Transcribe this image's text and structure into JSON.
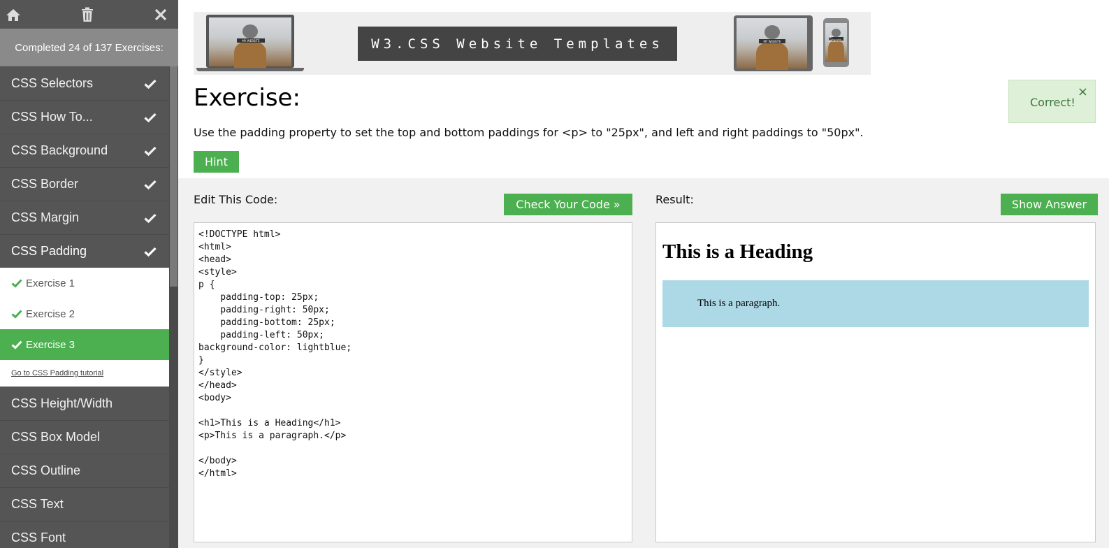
{
  "sidebar": {
    "progress_text": "Completed 24 of 137 Exercises:",
    "items_top": [
      {
        "label": "CSS Selectors",
        "completed": true
      },
      {
        "label": "CSS How To...",
        "completed": true
      },
      {
        "label": "CSS Background",
        "completed": true
      },
      {
        "label": "CSS Border",
        "completed": true
      },
      {
        "label": "CSS Margin",
        "completed": true
      },
      {
        "label": "CSS Padding",
        "completed": true
      }
    ],
    "sub_items": [
      {
        "label": "Exercise 1",
        "completed": true
      },
      {
        "label": "Exercise 2",
        "completed": true
      },
      {
        "label": "Exercise 3",
        "completed": true,
        "current": true
      }
    ],
    "tutorial_link": "Go to CSS Padding tutorial",
    "items_bottom": [
      {
        "label": "CSS Height/Width"
      },
      {
        "label": "CSS Box Model"
      },
      {
        "label": "CSS Outline"
      },
      {
        "label": "CSS Text"
      },
      {
        "label": "CSS Font"
      }
    ]
  },
  "banner": {
    "button_text": "W3.CSS Website Templates",
    "photo_tag": "MY WEBSITE"
  },
  "exercise": {
    "title": "Exercise:",
    "instructions": "Use the padding property to set the top and bottom paddings for <p> to \"25px\", and left and right paddings to \"50px\".",
    "hint_label": "Hint"
  },
  "feedback": {
    "text": "Correct!",
    "close_glyph": "×"
  },
  "editor": {
    "label": "Edit This Code:",
    "check_label": "Check Your Code »",
    "code": "<!DOCTYPE html>\n<html>\n<head>\n<style>\np {\n    padding-top: 25px;\n    padding-right: 50px;\n    padding-bottom: 25px;\n    padding-left: 50px;\nbackground-color: lightblue;\n}\n</style>\n</head>\n<body>\n\n<h1>This is a Heading</h1>\n<p>This is a paragraph.</p>\n\n</body>\n</html>"
  },
  "result": {
    "label": "Result:",
    "show_answer_label": "Show Answer",
    "heading": "This is a Heading",
    "paragraph": "This is a paragraph.",
    "paragraph_bg": "#add8e6"
  },
  "colors": {
    "accent_green": "#4caf50",
    "sidebar_bg": "#555555",
    "progress_bg": "#8a8a8a",
    "feedback_bg": "#dff0d8",
    "feedback_text": "#3c763d"
  }
}
